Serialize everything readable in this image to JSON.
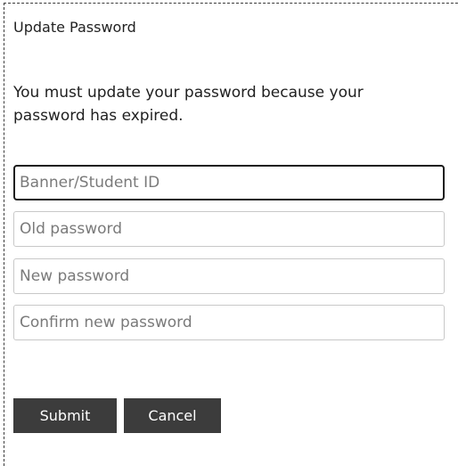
{
  "form": {
    "title": "Update Password",
    "message": "You must update your password because your password has expired.",
    "fields": {
      "banner_id": {
        "placeholder": "Banner/Student ID",
        "value": ""
      },
      "old_password": {
        "placeholder": "Old password",
        "value": ""
      },
      "new_password": {
        "placeholder": "New password",
        "value": ""
      },
      "confirm_password": {
        "placeholder": "Confirm new password",
        "value": ""
      }
    },
    "buttons": {
      "submit_label": "Submit",
      "cancel_label": "Cancel"
    }
  },
  "colors": {
    "button_bg": "#3c3c3c",
    "button_text": "#ffffff",
    "field_border": "#c8c8c8",
    "focused_border": "#1a1a1a"
  }
}
